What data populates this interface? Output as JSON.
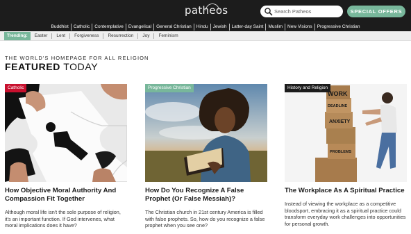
{
  "header": {
    "logo_text": "patheos",
    "search_placeholder": "Search Patheos",
    "special_offers_label": "SPECIAL OFFERS"
  },
  "category_nav": [
    "Buddhist",
    "Catholic",
    "Contemplative",
    "Evangelical",
    "General Christian",
    "Hindu",
    "Jewish",
    "Latter-day Saint",
    "Muslim",
    "New Visions",
    "Progressive Christian"
  ],
  "trending": {
    "label": "Trending:",
    "items": [
      "Easter",
      "Lent",
      "Forgiveness",
      "Resurrection",
      "Joy",
      "Feminism"
    ]
  },
  "featured": {
    "kicker": "THE WORLD'S HOMEPAGE FOR ALL RELIGION",
    "title_bold": "FEATURED",
    "title_light": "TODAY"
  },
  "cards": [
    {
      "badge": "Catholic",
      "badge_color": "#c8102e",
      "title": "How Objective Moral Authority And Compassion Fit Together",
      "excerpt": "Although moral life isn't the sole purpose of religion, it's an important function. If God intervenes, what moral implications does it have?"
    },
    {
      "badge": "Progressive Christian",
      "badge_color": "#78b79b",
      "title": "How Do You Recognize A False Prophet (Or False Messiah)?",
      "excerpt": "The Christian church in 21st century America is filled with false prophets. So, how do you recognize a false prophet when you see one?"
    },
    {
      "badge": "History and Religion",
      "badge_color": "#1c1c1c",
      "title": "The Workplace As A Spiritual Practice",
      "excerpt": "Instead of viewing the workplace as a competitive bloodsport, embracing it as a spiritual practice could transform everyday work challenges into opportunities for personal growth.",
      "box_labels": [
        "WORK",
        "DEADLINE",
        "ANXIETY",
        "PROBLEMS"
      ]
    }
  ]
}
